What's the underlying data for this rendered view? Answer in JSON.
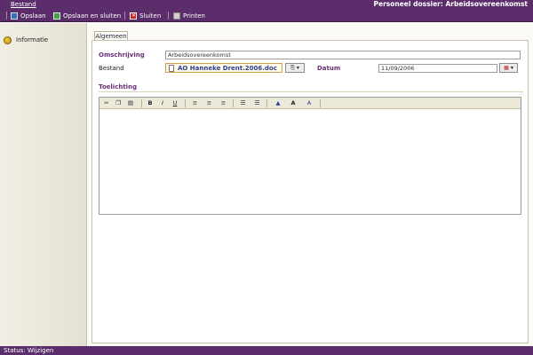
{
  "menu": {
    "bestand": "Bestand"
  },
  "app_title": "Personeel dossier: Arbeidsovereenkomst",
  "toolbar": {
    "opslaan": "Opslaan",
    "opslaan_sluiten": "Opslaan en sluiten",
    "sluiten": "Sluiten",
    "printen": "Printen"
  },
  "sidebar": {
    "items": [
      {
        "label": "Informatie",
        "icon": "info-icon"
      }
    ]
  },
  "tabs": [
    {
      "label": "Algemeen"
    }
  ],
  "form": {
    "omschrijving_label": "Omschrijving",
    "omschrijving_value": "Arbeidsovereenkomst",
    "bestand_label": "Bestand",
    "bestand_file": "AO Hanneke Drent.2006.doc",
    "datum_label": "Datum",
    "datum_value": "11/09/2006",
    "toelichting_label": "Toelichting"
  },
  "editor_toolbar": {
    "bold": "B",
    "italic": "I",
    "underline": "U",
    "font_size": "A",
    "font_color": "A"
  },
  "status": {
    "text": "Status: Wijzigen"
  },
  "colors": {
    "accent": "#5c2d6b",
    "label_accent": "#6b2f7a",
    "file_link": "#2b3f9a"
  }
}
